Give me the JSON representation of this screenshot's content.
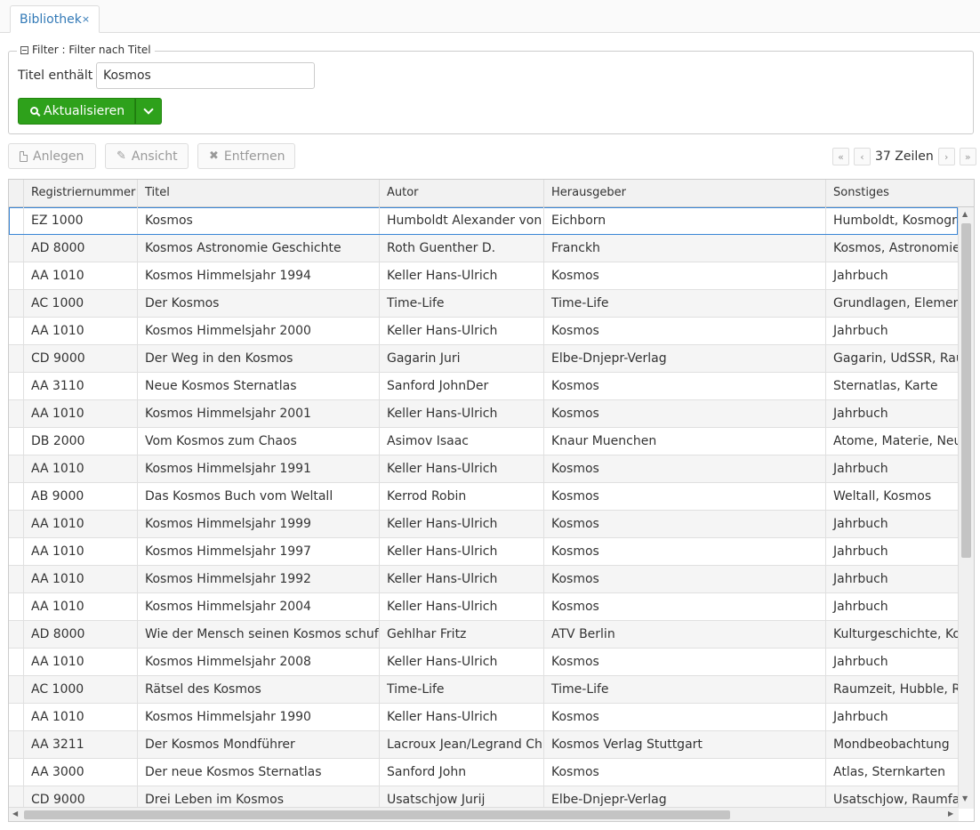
{
  "tab": {
    "label": "Bibliothek",
    "close": "×"
  },
  "filter": {
    "legend": "Filter : Filter nach Titel",
    "title_label": "Titel enthält",
    "title_value": "Kosmos",
    "refresh_label": "Aktualisieren"
  },
  "toolbar": {
    "new_label": "Anlegen",
    "view_label": "Ansicht",
    "delete_label": "Entfernen"
  },
  "pager": {
    "first": "«",
    "prev": "‹",
    "next": "›",
    "last": "»",
    "count_text": "37 Zeilen"
  },
  "grid": {
    "columns": [
      "Registriernummer",
      "Titel",
      "Autor",
      "Herausgeber",
      "Sonstiges"
    ],
    "rows": [
      [
        "EZ 1000",
        "Kosmos",
        "Humboldt Alexander von",
        "Eichborn",
        "Humboldt, Kosmographie"
      ],
      [
        "AD 8000",
        "Kosmos Astronomie Geschichte",
        "Roth Guenther D.",
        "Franckh",
        "Kosmos, Astronomie, Geschichte"
      ],
      [
        "AA 1010",
        "Kosmos Himmelsjahr 1994",
        "Keller Hans-Ulrich",
        "Kosmos",
        "Jahrbuch"
      ],
      [
        "AC 1000",
        "Der Kosmos",
        "Time-Life",
        "Time-Life",
        "Grundlagen, Elementarteilchen"
      ],
      [
        "AA 1010",
        "Kosmos Himmelsjahr 2000",
        "Keller Hans-Ulrich",
        "Kosmos",
        "Jahrbuch"
      ],
      [
        "CD 9000",
        "Der Weg in den Kosmos",
        "Gagarin Juri",
        "Elbe-Dnjepr-Verlag",
        "Gagarin, UdSSR, Raumfahrt"
      ],
      [
        "AA 3110",
        "Neue Kosmos Sternatlas",
        "Sanford JohnDer",
        "Kosmos",
        "Sternatlas, Karte"
      ],
      [
        "AA 1010",
        "Kosmos Himmelsjahr 2001",
        "Keller Hans-Ulrich",
        "Kosmos",
        "Jahrbuch"
      ],
      [
        "DB 2000",
        "Vom Kosmos zum Chaos",
        "Asimov Isaac",
        "Knaur Muenchen",
        "Atome, Materie, Neutrinos"
      ],
      [
        "AA 1010",
        "Kosmos Himmelsjahr 1991",
        "Keller Hans-Ulrich",
        "Kosmos",
        "Jahrbuch"
      ],
      [
        "AB 9000",
        "Das Kosmos Buch vom Weltall",
        "Kerrod Robin",
        "Kosmos",
        "Weltall, Kosmos"
      ],
      [
        "AA 1010",
        "Kosmos Himmelsjahr 1999",
        "Keller Hans-Ulrich",
        "Kosmos",
        "Jahrbuch"
      ],
      [
        "AA 1010",
        "Kosmos Himmelsjahr 1997",
        "Keller Hans-Ulrich",
        "Kosmos",
        "Jahrbuch"
      ],
      [
        "AA 1010",
        "Kosmos Himmelsjahr 1992",
        "Keller Hans-Ulrich",
        "Kosmos",
        "Jahrbuch"
      ],
      [
        "AA 1010",
        "Kosmos Himmelsjahr 2004",
        "Keller Hans-Ulrich",
        "Kosmos",
        "Jahrbuch"
      ],
      [
        "AD 8000",
        "Wie der Mensch seinen Kosmos schuf",
        "Gehlhar Fritz",
        "ATV Berlin",
        "Kulturgeschichte, Kosmos"
      ],
      [
        "AA 1010",
        "Kosmos Himmelsjahr 2008",
        "Keller Hans-Ulrich",
        "Kosmos",
        "Jahrbuch"
      ],
      [
        "AC 1000",
        "Rätsel des Kosmos",
        "Time-Life",
        "Time-Life",
        "Raumzeit, Hubble, Rotverschiebung"
      ],
      [
        "AA 1010",
        "Kosmos Himmelsjahr 1990",
        "Keller Hans-Ulrich",
        "Kosmos",
        "Jahrbuch"
      ],
      [
        "AA 3211",
        "Der Kosmos Mondführer",
        "Lacroux Jean/Legrand Christian",
        "Kosmos Verlag Stuttgart",
        "Mondbeobachtung"
      ],
      [
        "AA 3000",
        "Der neue Kosmos Sternatlas",
        "Sanford John",
        "Kosmos",
        "Atlas, Sternkarten"
      ],
      [
        "CD 9000",
        "Drei Leben im Kosmos",
        "Usatschjow Jurij",
        "Elbe-Dnjepr-Verlag",
        "Usatschjow, Raumfahrt"
      ]
    ]
  }
}
